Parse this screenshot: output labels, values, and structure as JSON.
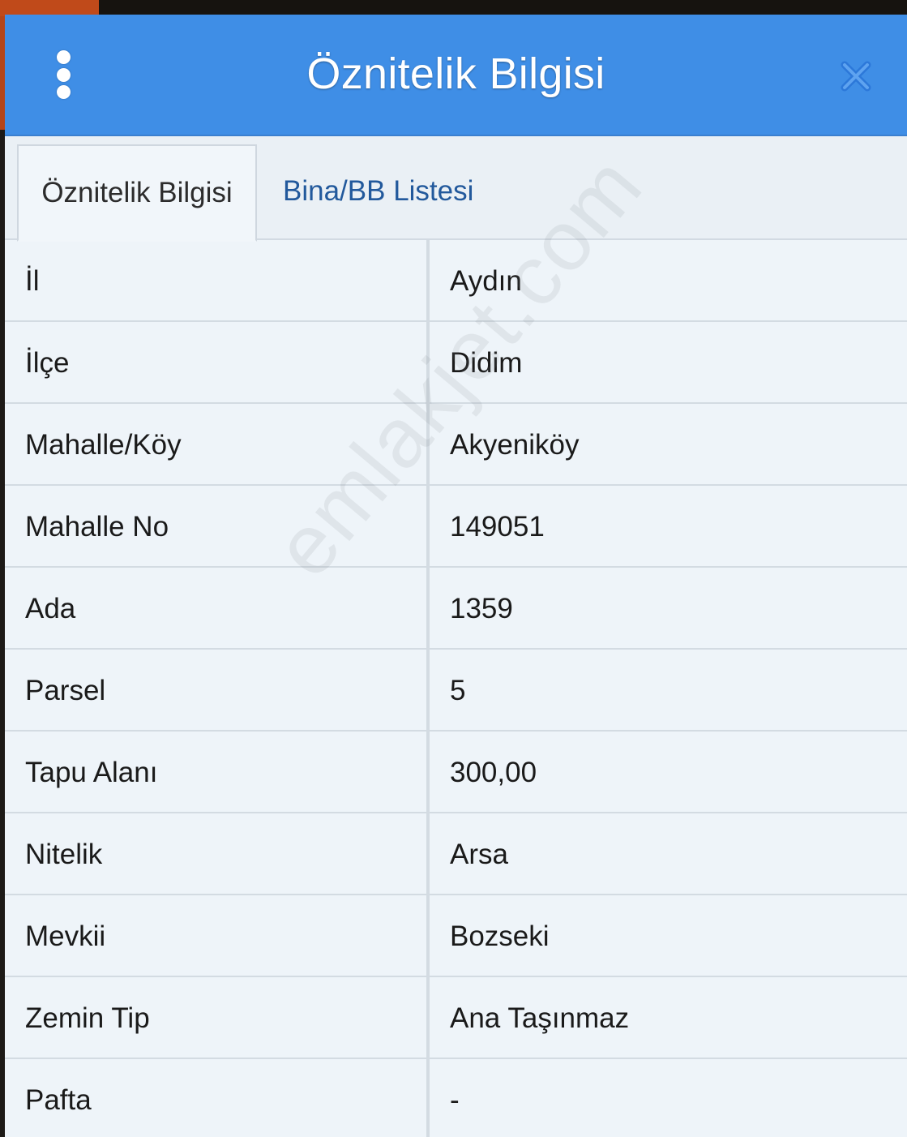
{
  "header": {
    "title": "Öznitelik Bilgisi",
    "menu_icon": "kebab-vertical-icon",
    "close_icon": "close-icon",
    "header_color": "#3f8ee6"
  },
  "tabs": [
    {
      "label": "Öznitelik Bilgisi",
      "active": true
    },
    {
      "label": "Bina/BB Listesi",
      "active": false
    }
  ],
  "attributes": [
    {
      "key": "İl",
      "value": "Aydın"
    },
    {
      "key": "İlçe",
      "value": "Didim"
    },
    {
      "key": "Mahalle/Köy",
      "value": "Akyeniköy"
    },
    {
      "key": "Mahalle No",
      "value": "149051"
    },
    {
      "key": "Ada",
      "value": "1359"
    },
    {
      "key": "Parsel",
      "value": "5"
    },
    {
      "key": "Tapu Alanı",
      "value": "300,00"
    },
    {
      "key": "Nitelik",
      "value": "Arsa"
    },
    {
      "key": "Mevkii",
      "value": "Bozseki"
    },
    {
      "key": "Zemin Tip",
      "value": "Ana Taşınmaz"
    },
    {
      "key": "Pafta",
      "value": "-"
    }
  ],
  "watermark": "emlakjet.com"
}
